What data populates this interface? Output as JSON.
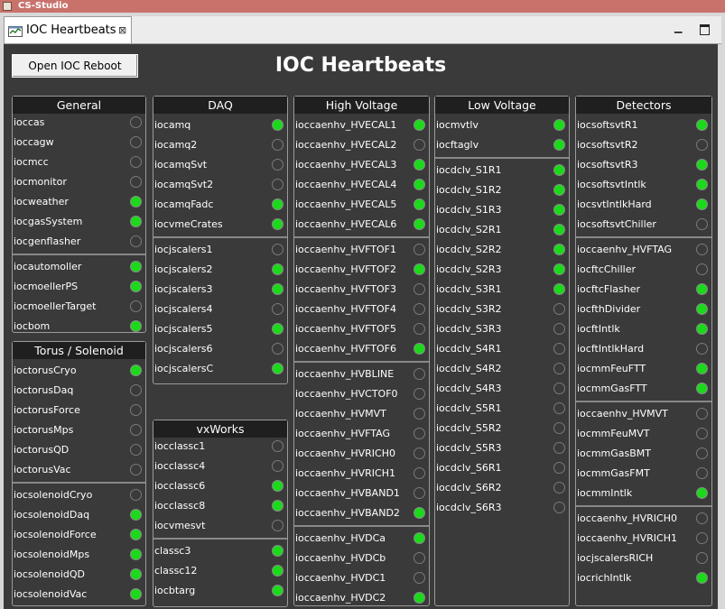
{
  "window": {
    "title": "CS-Studio",
    "controls": {
      "minimize": "–",
      "maximize": "□",
      "close": "✕"
    }
  },
  "tab": {
    "label": "IOC Heartbeats",
    "close": "⊠"
  },
  "view": {
    "minimize_label": "▁",
    "heading": "IOC Heartbeats",
    "reboot_button": "Open IOC Reboot"
  },
  "colors": {
    "on": "#1cd91c",
    "off": "#3a3a3a",
    "background": "#3a3a3a"
  },
  "panels": [
    {
      "id": "general",
      "title": "General",
      "groups": [
        [
          {
            "name": "ioccas",
            "on": false
          },
          {
            "name": "ioccagw",
            "on": false
          },
          {
            "name": "iocmcc",
            "on": false
          },
          {
            "name": "iocmonitor",
            "on": false
          },
          {
            "name": "iocweather",
            "on": true
          },
          {
            "name": "iocgasSystem",
            "on": true
          },
          {
            "name": "iocgenflasher",
            "on": false
          }
        ],
        [
          {
            "name": "iocautomoller",
            "on": true
          },
          {
            "name": "iocmoellerPS",
            "on": true
          },
          {
            "name": "iocmoellerTarget",
            "on": false
          },
          {
            "name": "iocbom",
            "on": true
          }
        ]
      ]
    },
    {
      "id": "torus",
      "title": "Torus / Solenoid",
      "groups": [
        [
          {
            "name": "ioctorusCryo",
            "on": true
          },
          {
            "name": "ioctorusDaq",
            "on": false
          },
          {
            "name": "ioctorusForce",
            "on": false
          },
          {
            "name": "ioctorusMps",
            "on": false
          },
          {
            "name": "ioctorusQD",
            "on": false
          },
          {
            "name": "ioctorusVac",
            "on": false
          }
        ],
        [
          {
            "name": "iocsolenoidCryo",
            "on": false
          },
          {
            "name": "iocsolenoidDaq",
            "on": true
          },
          {
            "name": "iocsolenoidForce",
            "on": true
          },
          {
            "name": "iocsolenoidMps",
            "on": true
          },
          {
            "name": "iocsolenoidQD",
            "on": true
          },
          {
            "name": "iocsolenoidVac",
            "on": true
          }
        ]
      ]
    },
    {
      "id": "daq",
      "title": "DAQ",
      "groups": [
        [
          {
            "name": "iocamq",
            "on": true
          },
          {
            "name": "iocamq2",
            "on": false
          },
          {
            "name": "iocamqSvt",
            "on": false
          },
          {
            "name": "iocamqSvt2",
            "on": false
          },
          {
            "name": "iocamqFadc",
            "on": true
          },
          {
            "name": "iocvmeCrates",
            "on": true
          }
        ],
        [
          {
            "name": "iocjscalers1",
            "on": false
          },
          {
            "name": "iocjscalers2",
            "on": true
          },
          {
            "name": "iocjscalers3",
            "on": true
          },
          {
            "name": "iocjscalers4",
            "on": false
          },
          {
            "name": "iocjscalers5",
            "on": true
          },
          {
            "name": "iocjscalers6",
            "on": false
          },
          {
            "name": "iocjscalersC",
            "on": true
          }
        ]
      ]
    },
    {
      "id": "vxworks",
      "title": "vxWorks",
      "groups": [
        [
          {
            "name": "iocclassc1",
            "on": false
          },
          {
            "name": "iocclassc4",
            "on": false
          },
          {
            "name": "iocclassc6",
            "on": true
          },
          {
            "name": "iocclassc8",
            "on": true
          },
          {
            "name": "iocvmesvt",
            "on": false
          }
        ],
        [
          {
            "name": "classc3",
            "on": true
          },
          {
            "name": "classc12",
            "on": true
          },
          {
            "name": "iocbtarg",
            "on": true
          }
        ]
      ]
    },
    {
      "id": "hv",
      "title": "High Voltage",
      "groups": [
        [
          {
            "name": "ioccaenhv_HVECAL1",
            "on": true
          },
          {
            "name": "ioccaenhv_HVECAL2",
            "on": false
          },
          {
            "name": "ioccaenhv_HVECAL3",
            "on": true
          },
          {
            "name": "ioccaenhv_HVECAL4",
            "on": true
          },
          {
            "name": "ioccaenhv_HVECAL5",
            "on": true
          },
          {
            "name": "ioccaenhv_HVECAL6",
            "on": true
          }
        ],
        [
          {
            "name": "ioccaenhv_HVFTOF1",
            "on": false
          },
          {
            "name": "ioccaenhv_HVFTOF2",
            "on": true
          },
          {
            "name": "ioccaenhv_HVFTOF3",
            "on": false
          },
          {
            "name": "ioccaenhv_HVFTOF4",
            "on": false
          },
          {
            "name": "ioccaenhv_HVFTOF5",
            "on": false
          },
          {
            "name": "ioccaenhv_HVFTOF6",
            "on": true
          }
        ],
        [
          {
            "name": "ioccaenhv_HVBLINE",
            "on": false
          },
          {
            "name": "ioccaenhv_HVCTOF0",
            "on": false
          },
          {
            "name": "ioccaenhv_HVMVT",
            "on": false
          },
          {
            "name": "ioccaenhv_HVFTAG",
            "on": false
          },
          {
            "name": "ioccaenhv_HVRICH0",
            "on": false
          },
          {
            "name": "ioccaenhv_HVRICH1",
            "on": false
          },
          {
            "name": "ioccaenhv_HVBAND1",
            "on": false
          },
          {
            "name": "ioccaenhv_HVBAND2",
            "on": true
          }
        ],
        [
          {
            "name": "ioccaenhv_HVDCa",
            "on": true
          },
          {
            "name": "ioccaenhv_HVDCb",
            "on": false
          },
          {
            "name": "ioccaenhv_HVDC1",
            "on": false
          },
          {
            "name": "ioccaenhv_HVDC2",
            "on": true
          }
        ]
      ]
    },
    {
      "id": "lv",
      "title": "Low Voltage",
      "groups": [
        [
          {
            "name": "iocmvtlv",
            "on": true
          },
          {
            "name": "iocftaglv",
            "on": true
          }
        ],
        [
          {
            "name": "iocdclv_S1R1",
            "on": true
          },
          {
            "name": "iocdclv_S1R2",
            "on": true
          },
          {
            "name": "iocdclv_S1R3",
            "on": true
          },
          {
            "name": "iocdclv_S2R1",
            "on": true
          },
          {
            "name": "iocdclv_S2R2",
            "on": true
          },
          {
            "name": "iocdclv_S2R3",
            "on": true
          },
          {
            "name": "iocdclv_S3R1",
            "on": true
          },
          {
            "name": "iocdclv_S3R2",
            "on": false
          },
          {
            "name": "iocdclv_S3R3",
            "on": false
          },
          {
            "name": "iocdclv_S4R1",
            "on": false
          },
          {
            "name": "iocdclv_S4R2",
            "on": false
          },
          {
            "name": "iocdclv_S4R3",
            "on": false
          },
          {
            "name": "iocdclv_S5R1",
            "on": false
          },
          {
            "name": "iocdclv_S5R2",
            "on": false
          },
          {
            "name": "iocdclv_S5R3",
            "on": false
          },
          {
            "name": "iocdclv_S6R1",
            "on": false
          },
          {
            "name": "iocdclv_S6R2",
            "on": false
          },
          {
            "name": "iocdclv_S6R3",
            "on": false
          }
        ]
      ]
    },
    {
      "id": "detectors",
      "title": "Detectors",
      "groups": [
        [
          {
            "name": "iocsoftsvtR1",
            "on": true
          },
          {
            "name": "iocsoftsvtR2",
            "on": false
          },
          {
            "name": "iocsoftsvtR3",
            "on": true
          },
          {
            "name": "iocsoftsvtIntlk",
            "on": true
          },
          {
            "name": "iocsvtIntlkHard",
            "on": true
          },
          {
            "name": "iocsoftsvtChiller",
            "on": false
          }
        ],
        [
          {
            "name": "ioccaenhv_HVFTAG",
            "on": false
          },
          {
            "name": "iocftcChiller",
            "on": false
          },
          {
            "name": "iocftcFlasher",
            "on": true
          },
          {
            "name": "iocfthDivider",
            "on": true
          },
          {
            "name": "iocftIntlk",
            "on": true
          },
          {
            "name": "iocftIntlkHard",
            "on": false
          },
          {
            "name": "iocmmFeuFTT",
            "on": true
          },
          {
            "name": "iocmmGasFTT",
            "on": true
          }
        ],
        [
          {
            "name": "ioccaenhv_HVMVT",
            "on": false
          },
          {
            "name": "iocmmFeuMVT",
            "on": false
          },
          {
            "name": "iocmmGasBMT",
            "on": false
          },
          {
            "name": "iocmmGasFMT",
            "on": false
          },
          {
            "name": "iocmmIntlk",
            "on": true
          }
        ],
        [
          {
            "name": "ioccaenhv_HVRICH0",
            "on": false
          },
          {
            "name": "ioccaenhv_HVRICH1",
            "on": false
          },
          {
            "name": "iocjscalersRICH",
            "on": false
          },
          {
            "name": "iocrichIntlk",
            "on": true
          }
        ]
      ]
    }
  ]
}
